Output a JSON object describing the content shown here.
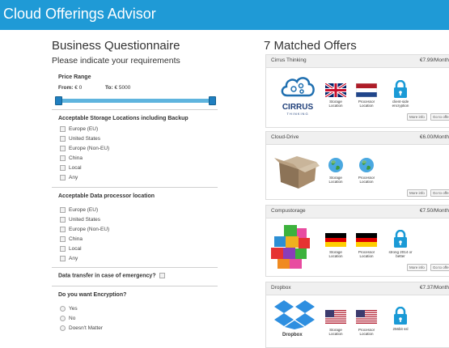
{
  "header": {
    "title": "Cloud Offerings Advisor"
  },
  "questionnaire": {
    "title": "Business Questionnaire",
    "subtitle": "Please indicate your requirements",
    "price": {
      "heading": "Price Range",
      "from_label": "From:",
      "from_value": "€ 0",
      "to_label": "To:",
      "to_value": "€ 5000"
    },
    "storage": {
      "heading": "Acceptable Storage Locations including Backup",
      "options": [
        "Europe (EU)",
        "United States",
        "Europe (Non-EU)",
        "China",
        "Local",
        "Any"
      ]
    },
    "processor": {
      "heading": "Acceptable Data processor location",
      "options": [
        "Europe (EU)",
        "United States",
        "Europe (Non-EU)",
        "China",
        "Local",
        "Any"
      ]
    },
    "emergency": {
      "label": "Data transfer in case of emergency?"
    },
    "encryption": {
      "heading": "Do you want Encryption?",
      "options": [
        "Yes",
        "No",
        "Doesn't Matter"
      ]
    }
  },
  "offers": {
    "title": "7 Matched Offers",
    "more_info": "More info",
    "go_to": "Go to offe",
    "storage_label": "Storage Location",
    "processor_label": "Processor Location",
    "items": [
      {
        "name": "Cirrus Thinking",
        "price": "€7.99/Month",
        "logo_text": "CIRRUS",
        "logo_sub": "THINKING",
        "enc": "client-side encryption"
      },
      {
        "name": "Cloud-Drive",
        "price": "€6.00/Month"
      },
      {
        "name": "Compustorage",
        "price": "€7.50/Month",
        "enc": "strong 2014 or better"
      },
      {
        "name": "Dropbox",
        "price": "€7.37/Month",
        "logo_text": "Dropbox",
        "enc": "256bit ssl"
      }
    ]
  }
}
